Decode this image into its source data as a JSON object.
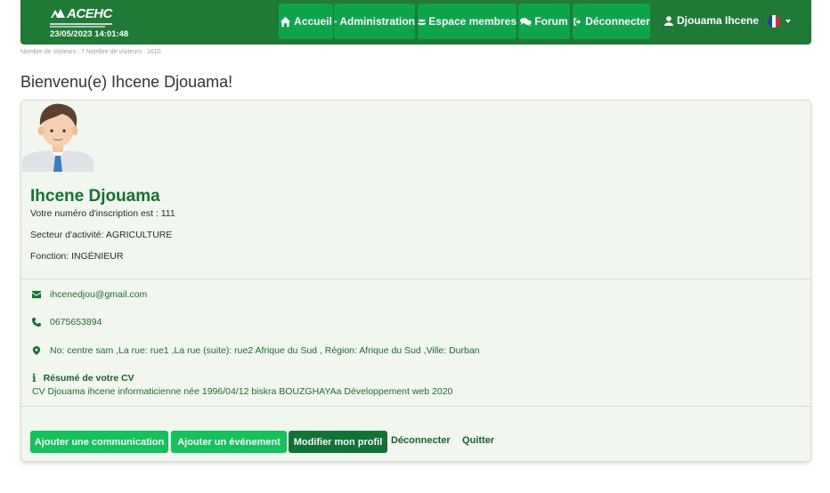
{
  "header": {
    "logo_text": "ACEHC",
    "datetime": "23/05/2023 14:01:48",
    "nav": {
      "home": "Accueil",
      "admin": "Administration",
      "members": "Espace membres",
      "forum": "Forum",
      "logout": "Déconnecter"
    },
    "user_name": "Djouama Ihcene",
    "language_flag": "fr-flag"
  },
  "visitor_counter": "Nombre de visiteurs : 7 Nombre de visiteurs : 1610",
  "welcome_title": "Bienvenu(e) Ihcene Djouama!",
  "profile": {
    "full_name": "Ihcene Djouama",
    "registration": "Votre numéro d'inscription est : 111",
    "sector": "Secteur d'activité: AGRICULTURE",
    "role": "Fonction: INGÉNIEUR",
    "email": "ihcenedjou@gmail.com",
    "phone": "0675653894",
    "address": "No: centre sam ,La rue: rue1 ,La rue (suite): rue2 Afrique du Sud , Région: Afrique du Sud ,Ville: Durban",
    "cv_title": "Résumé de votre CV",
    "cv_text": "CV Djouama ihcene informaticienne née 1996/04/12 biskra BOUZGHAYAa Développement web 2020"
  },
  "actions": {
    "add_communication": "Ajouter une communication",
    "add_event": "Ajouter un événement",
    "edit_profile": "Modifier mon profil",
    "logout": "Déconnecter",
    "quit": "Quitter"
  },
  "colors": {
    "navbar": "#1e7a34",
    "nav_button": "#0ea54a",
    "card_background": "#f1f7ee",
    "primary_button": "#13c25a",
    "dark_button": "#107234",
    "accent_text": "#137332"
  }
}
